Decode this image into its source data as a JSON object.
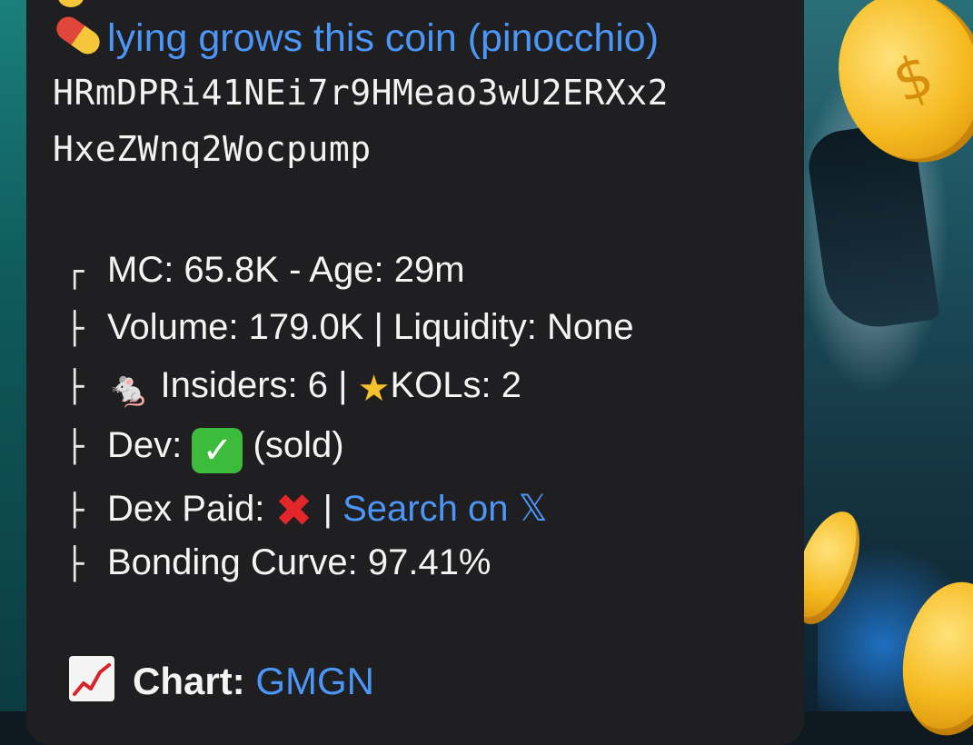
{
  "message": {
    "title": "lying grows this coin (pinocchio)",
    "title_icon": "pill-icon",
    "address_line1": "HRmDPRi41NEi7r9HMeao3wU2ERXx2",
    "address_line2": "HxeZWnq2Wocpump",
    "tree_chars": {
      "first": "┌",
      "mid": "├"
    },
    "stats": {
      "mc_line": "MC: 65.8K - Age: 29m",
      "volume_line": "Volume: 179.0K | Liquidity: None",
      "insiders_label": "Insiders: 6 |",
      "kols_label": "KOLs: 2",
      "dev_label": "Dev:",
      "dev_status": "(sold)",
      "dex_label": "Dex Paid:",
      "dex_sep": "|",
      "search_link": "Search on 𝕏",
      "bonding_line": "Bonding Curve: 97.41%"
    },
    "chart": {
      "label": "Chart:",
      "link": "GMGN"
    }
  },
  "colors": {
    "link": "#4c96f7",
    "bubble_bg": "#1f1f21",
    "text": "#f4f4f4",
    "check_green": "#3dbb3a",
    "cross_red": "#e2262a"
  },
  "icons": [
    "pill-icon",
    "rat-icon",
    "star-icon",
    "check-icon",
    "cross-icon",
    "chart-up-icon"
  ]
}
